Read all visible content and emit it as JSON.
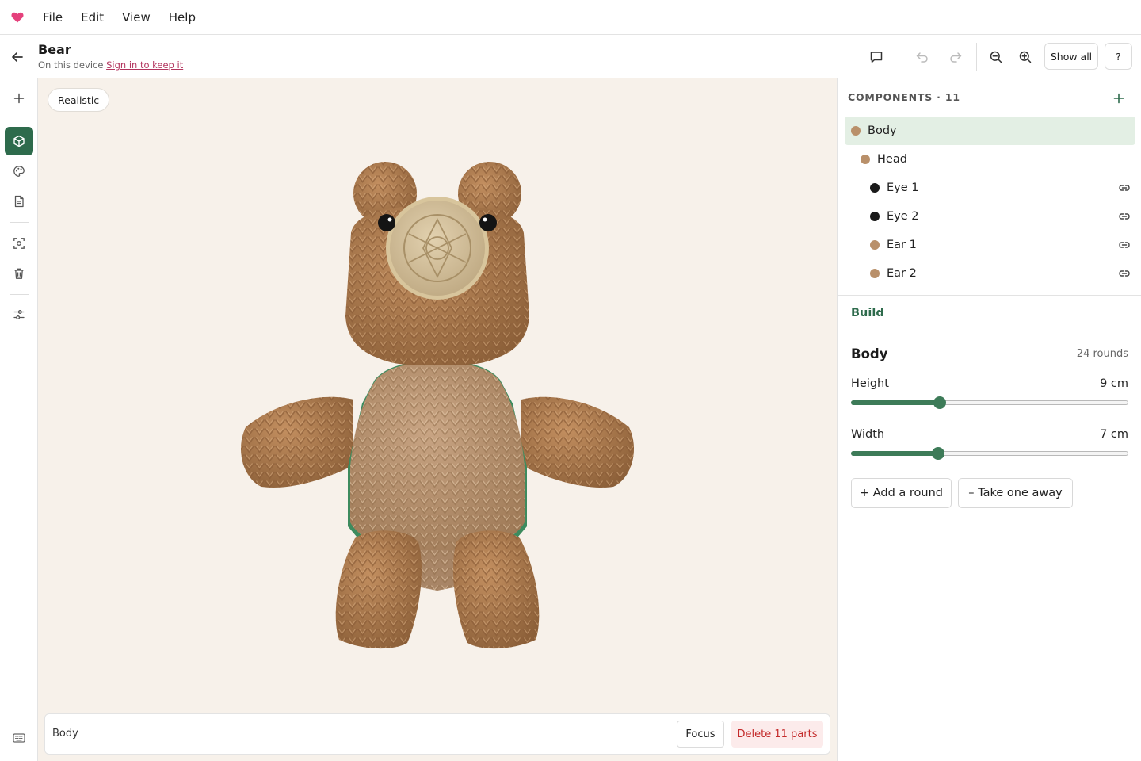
{
  "menubar": {
    "logo_icon": "heart-icon",
    "brand_color": "#e5417c",
    "items": [
      "File",
      "Edit",
      "View",
      "Help"
    ]
  },
  "titlebar": {
    "title": "Bear",
    "subtitle": "On this device",
    "signin_link": "Sign in to keep it",
    "show_all_label": "Show all",
    "help_label": "?"
  },
  "rail": {
    "active_color": "#2e6b4c",
    "items": [
      "plus-icon",
      "cube-icon",
      "palette-icon",
      "document-icon",
      "focus-icon",
      "trash-icon",
      "sliders-icon"
    ]
  },
  "canvas": {
    "mode": "Realistic",
    "selection_label": "Body",
    "focus_label": "Focus",
    "delete_label": "Delete 11 parts"
  },
  "components": {
    "header": "COMPONENTS · 11",
    "items": [
      {
        "name": "Body",
        "color": "#b9906a",
        "depth": 0,
        "selected": true,
        "linked": false
      },
      {
        "name": "Head",
        "color": "#b9906a",
        "depth": 1,
        "selected": false,
        "linked": false
      },
      {
        "name": "Eye 1",
        "color": "#1a1a1a",
        "depth": 2,
        "selected": false,
        "linked": true
      },
      {
        "name": "Eye 2",
        "color": "#1a1a1a",
        "depth": 2,
        "selected": false,
        "linked": true
      },
      {
        "name": "Ear 1",
        "color": "#b9906a",
        "depth": 2,
        "selected": false,
        "linked": true
      },
      {
        "name": "Ear 2",
        "color": "#b9906a",
        "depth": 2,
        "selected": false,
        "linked": true
      }
    ]
  },
  "build": {
    "section_label": "Build",
    "part_title": "Body",
    "rounds": "24 rounds",
    "height": {
      "label": "Height",
      "value": "9 cm",
      "fraction": 0.32
    },
    "width": {
      "label": "Width",
      "value": "7 cm",
      "fraction": 0.315
    },
    "add_round": "+ Add a round",
    "take_away": "– Take one away"
  }
}
